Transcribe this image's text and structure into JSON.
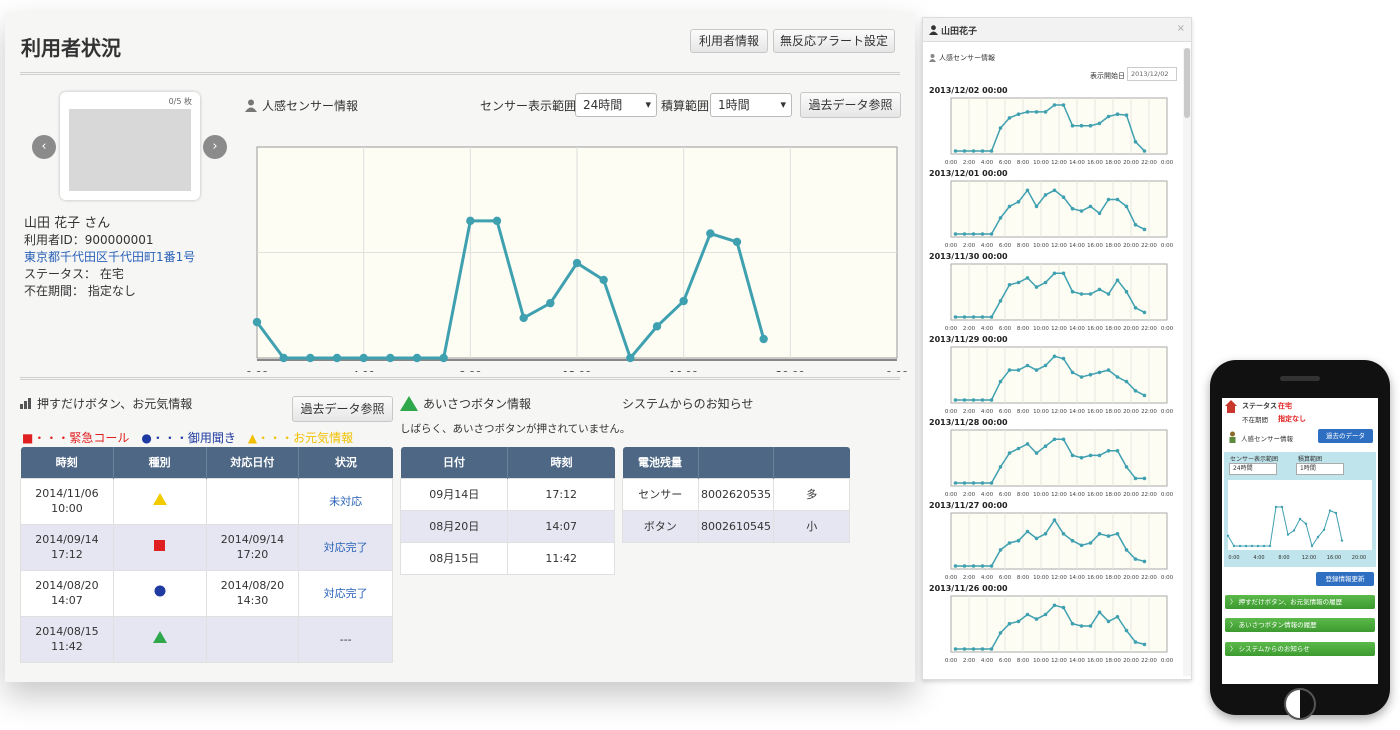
{
  "page": {
    "title": "利用者状況",
    "buttons": {
      "user_info": "利用者情報",
      "alert_settings": "無反応アラート設定",
      "history": "過去データ参照"
    },
    "photo_counter": "0/5 枚"
  },
  "user": {
    "name": "山田 花子 さん",
    "id_line": "利用者ID：900000001",
    "address": "東京都千代田区千代田町1番1号",
    "status_line": "ステータス： 在宅",
    "absence_line": "不在期間： 指定なし"
  },
  "sensor": {
    "title": "人感センサー情報",
    "range_label": "センサー表示範囲",
    "range_value": "24時間",
    "accum_label": "積算範囲",
    "accum_value": "1時間"
  },
  "chart_data": {
    "type": "line",
    "title": "",
    "xlabel": "",
    "ylabel": "",
    "x_ticks": [
      "0:00",
      "4:00",
      "8:00",
      "12:00",
      "16:00",
      "20:00",
      "0:00"
    ],
    "x": [
      0,
      1,
      2,
      3,
      4,
      5,
      6,
      7,
      8,
      9,
      10,
      11,
      12,
      13,
      14,
      15,
      16,
      17,
      18,
      19
    ],
    "values": [
      0.17,
      0,
      0,
      0,
      0,
      0,
      0,
      0,
      0.65,
      0.65,
      0.19,
      0.26,
      0.45,
      0.37,
      0,
      0.15,
      0.27,
      0.59,
      0.55,
      0.09
    ],
    "xlim": [
      0,
      24
    ],
    "ylim": [
      0,
      1
    ],
    "grid": true,
    "color": "#3fa0b0",
    "background": "#fdfdf4"
  },
  "push_section": {
    "title": "押すだけボタン、お元気情報",
    "history_button": "過去データ参照",
    "legend": [
      {
        "symbol": "■",
        "text": "・・・緊急コール",
        "color": "#e02020"
      },
      {
        "symbol": "●",
        "text": "・・・御用聞き",
        "color": "#1f3aa0"
      },
      {
        "symbol": "▲",
        "text": "・・・お元気情報",
        "color": "#f0c000"
      }
    ],
    "columns": [
      "時刻",
      "種別",
      "対応日付",
      "状況"
    ],
    "rows": [
      {
        "time": "2014/11/06 10:00",
        "kind": "triangle-yellow",
        "handled": "",
        "status": "未対応"
      },
      {
        "time": "2014/09/14 17:12",
        "kind": "square-red",
        "handled": "2014/09/14 17:20",
        "status": "対応完了"
      },
      {
        "time": "2014/08/20 14:07",
        "kind": "circle-blue",
        "handled": "2014/08/20 14:30",
        "status": "対応完了"
      },
      {
        "time": "2014/08/15 11:42",
        "kind": "triangle-green",
        "handled": "",
        "status": "---"
      }
    ]
  },
  "greeting": {
    "title": "あいさつボタン情報",
    "notice": "しばらく、あいさつボタンが押されていません。",
    "columns": [
      "日付",
      "時刻"
    ],
    "rows": [
      {
        "date": "09月14日",
        "time": "17:12"
      },
      {
        "date": "08月20日",
        "time": "14:07"
      },
      {
        "date": "08月15日",
        "time": "11:42"
      }
    ]
  },
  "system": {
    "title": "システムからのお知らせ",
    "columns": [
      "電池残量",
      "",
      ""
    ],
    "rows": [
      {
        "device": "センサー",
        "serial": "8002620535",
        "level": "多"
      },
      {
        "device": "ボタン",
        "serial": "8002610545",
        "level": "小"
      }
    ]
  },
  "side_panel": {
    "title": "山田花子",
    "close": "×",
    "section": "人感センサー情報",
    "start_label": "表示開始日",
    "start_value": "2013/12/02",
    "tick_labels": [
      "0:00",
      "2:00",
      "4:00",
      "6:00",
      "8:00",
      "10:00",
      "12:00",
      "14:00",
      "16:00",
      "18:00",
      "20:00",
      "22:00",
      "0:00"
    ],
    "days": [
      {
        "date": "2013/12/02 00:00",
        "values": [
          0,
          0,
          0,
          0,
          0,
          0.5,
          0.72,
          0.8,
          0.85,
          0.85,
          0.85,
          1,
          1,
          0.55,
          0.55,
          0.55,
          0.6,
          0.75,
          0.8,
          0.78,
          0.2,
          0
        ]
      },
      {
        "date": "2013/12/01 00:00",
        "values": [
          0,
          0,
          0,
          0,
          0,
          0.35,
          0.6,
          0.7,
          0.95,
          0.6,
          0.85,
          0.95,
          0.8,
          0.55,
          0.5,
          0.6,
          0.45,
          0.75,
          0.75,
          0.6,
          0.2,
          0.1
        ]
      },
      {
        "date": "2013/11/30 00:00",
        "values": [
          0,
          0,
          0,
          0,
          0,
          0.35,
          0.7,
          0.75,
          0.85,
          0.65,
          0.75,
          0.95,
          0.95,
          0.55,
          0.5,
          0.5,
          0.6,
          0.5,
          0.8,
          0.55,
          0.2,
          0.1
        ]
      },
      {
        "date": "2013/11/29 00:00",
        "values": [
          0,
          0,
          0,
          0,
          0,
          0.4,
          0.65,
          0.65,
          0.75,
          0.65,
          0.75,
          0.95,
          0.9,
          0.6,
          0.5,
          0.55,
          0.6,
          0.65,
          0.5,
          0.4,
          0.2,
          0.1
        ]
      },
      {
        "date": "2013/11/28 00:00",
        "values": [
          0,
          0,
          0,
          0,
          0,
          0.35,
          0.65,
          0.75,
          0.85,
          0.65,
          0.8,
          0.95,
          0.95,
          0.6,
          0.55,
          0.6,
          0.6,
          0.7,
          0.7,
          0.35,
          0.1,
          0.1
        ]
      },
      {
        "date": "2013/11/27 00:00",
        "values": [
          0,
          0,
          0,
          0,
          0,
          0.35,
          0.5,
          0.55,
          0.75,
          0.6,
          0.7,
          1,
          0.7,
          0.55,
          0.45,
          0.5,
          0.7,
          0.65,
          0.7,
          0.35,
          0.15,
          0.1
        ]
      },
      {
        "date": "2013/11/26 00:00",
        "values": [
          0,
          0,
          0,
          0,
          0,
          0.35,
          0.55,
          0.6,
          0.75,
          0.65,
          0.75,
          0.95,
          0.9,
          0.55,
          0.5,
          0.5,
          0.8,
          0.6,
          0.7,
          0.4,
          0.15,
          0.1
        ]
      }
    ]
  },
  "phone": {
    "status_label": "ステータス",
    "status_value": "在宅",
    "absence_label": "不在期間",
    "absence_value": "指定なし",
    "sensor_title": "人感センサー情報",
    "history_btn": "過去のデータ",
    "range_label": "センサー表示範囲",
    "accum_label": "積算範囲",
    "range_value": "24時間",
    "accum_value": "1時間",
    "tick_labels": [
      "0:00",
      "4:00",
      "8:00",
      "12:00",
      "16:00",
      "20:00"
    ],
    "update_btn": "登録情報更新",
    "links": [
      "〉 押すだけボタン、お元気情報の履歴",
      "〉 あいさつボタン情報の履歴",
      "〉 システムからのお知らせ"
    ]
  }
}
